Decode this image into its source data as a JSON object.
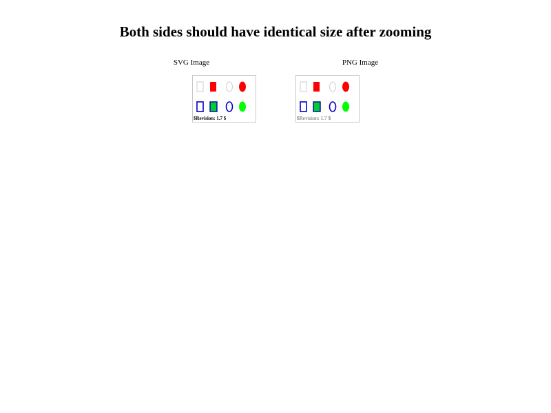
{
  "page": {
    "title": "Both sides should have identical size after zooming"
  },
  "svg_side": {
    "caption": "SVG Image",
    "revision": "$Revision: 1.7 $"
  },
  "png_side": {
    "caption": "PNG Image",
    "revision": "$Revision: 1.7 $"
  },
  "colors": {
    "red": "#ff0000",
    "blue": "#0000cc",
    "green": "#00ff00",
    "gray": "#cccccc"
  }
}
